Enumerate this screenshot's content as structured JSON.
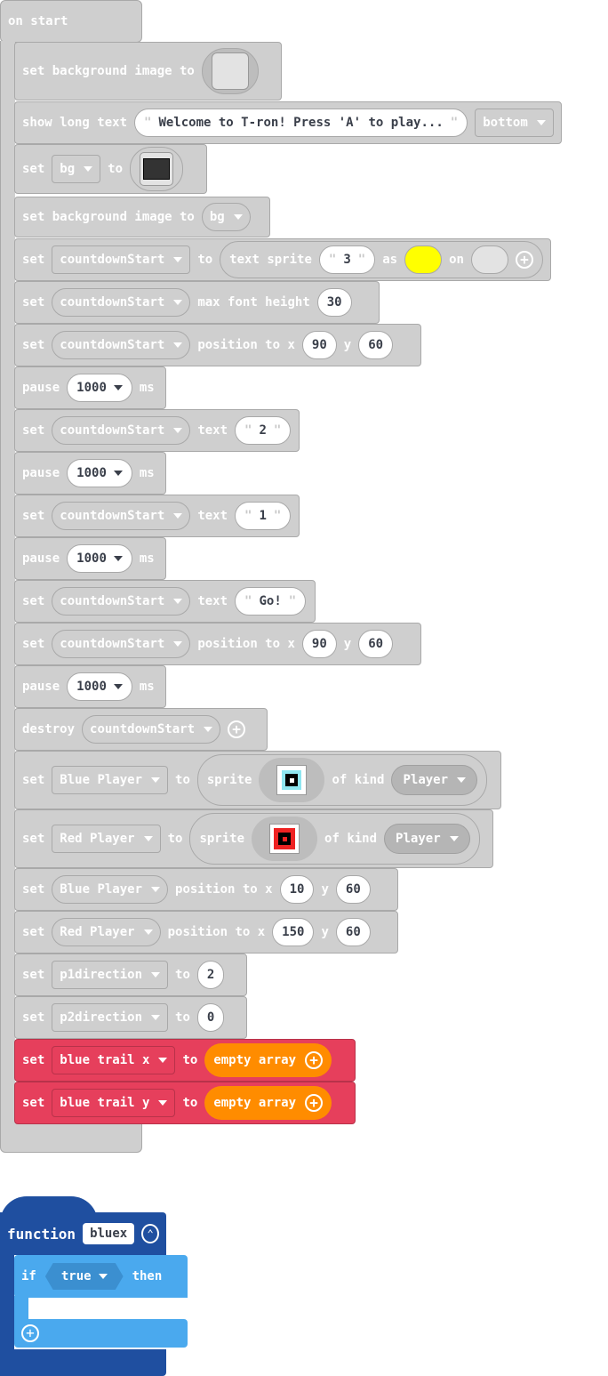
{
  "on_start": {
    "label": "on start",
    "bg_image_label": "set background image to",
    "show_text": {
      "label": "show long text",
      "value": "Welcome to T-ron! Press 'A' to play...",
      "position": "bottom"
    },
    "set_bg": {
      "set": "set",
      "var": "bg",
      "to": "to"
    },
    "set_bg_image_var": {
      "label": "set background image to",
      "var": "bg"
    },
    "text_sprite": {
      "set": "set",
      "var": "countdownStart",
      "to": "to",
      "label": "text sprite",
      "value": "3",
      "as": "as",
      "on": "on",
      "fg_color": "#ffff00"
    },
    "font_height": {
      "set": "set",
      "var": "countdownStart",
      "label": "max font height",
      "value": "30"
    },
    "position1": {
      "set": "set",
      "var": "countdownStart",
      "label": "position to x",
      "x": "90",
      "y_label": "y",
      "y": "60"
    },
    "pause1": {
      "label": "pause",
      "value": "1000",
      "unit": "ms"
    },
    "text2": {
      "set": "set",
      "var": "countdownStart",
      "label": "text",
      "value": "2"
    },
    "pause2": {
      "label": "pause",
      "value": "1000",
      "unit": "ms"
    },
    "text1": {
      "set": "set",
      "var": "countdownStart",
      "label": "text",
      "value": "1"
    },
    "pause3": {
      "label": "pause",
      "value": "1000",
      "unit": "ms"
    },
    "textgo": {
      "set": "set",
      "var": "countdownStart",
      "label": "text",
      "value": "Go!"
    },
    "position2": {
      "set": "set",
      "var": "countdownStart",
      "label": "position to x",
      "x": "90",
      "y_label": "y",
      "y": "60"
    },
    "pause4": {
      "label": "pause",
      "value": "1000",
      "unit": "ms"
    },
    "destroy": {
      "label": "destroy",
      "var": "countdownStart"
    },
    "blue_sprite": {
      "set": "set",
      "var": "Blue Player",
      "to": "to",
      "label": "sprite",
      "of_kind": "of kind",
      "kind": "Player"
    },
    "red_sprite": {
      "set": "set",
      "var": "Red Player",
      "to": "to",
      "label": "sprite",
      "of_kind": "of kind",
      "kind": "Player"
    },
    "blue_pos": {
      "set": "set",
      "var": "Blue Player",
      "label": "position to x",
      "x": "10",
      "y_label": "y",
      "y": "60"
    },
    "red_pos": {
      "set": "set",
      "var": "Red Player",
      "label": "position to x",
      "x": "150",
      "y_label": "y",
      "y": "60"
    },
    "p1dir": {
      "set": "set",
      "var": "p1direction",
      "to": "to",
      "value": "2"
    },
    "p2dir": {
      "set": "set",
      "var": "p2direction",
      "to": "to",
      "value": "0"
    },
    "trail_x": {
      "set": "set",
      "var": "blue trail x",
      "to": "to",
      "value": "empty array"
    },
    "trail_y": {
      "set": "set",
      "var": "blue trail y",
      "to": "to",
      "value": "empty array"
    }
  },
  "function_block": {
    "label": "function",
    "name": "bluex",
    "if_label": "if",
    "condition": "true",
    "then_label": "then"
  },
  "colors": {
    "grey": "#cfcfcf",
    "red": "#e63f5c",
    "orange": "#ff8c00",
    "func": "#1f4fa0",
    "logic": "#4aa9ee"
  }
}
